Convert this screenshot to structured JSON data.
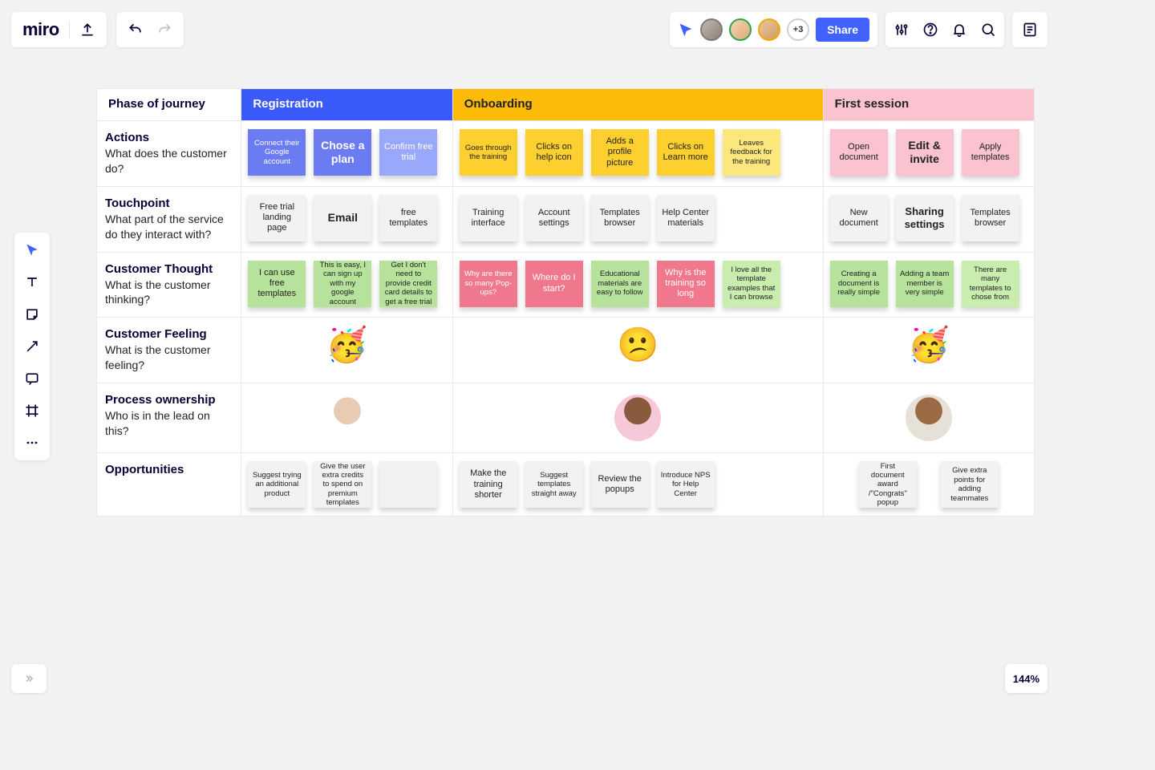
{
  "app": {
    "logo": "miro"
  },
  "toolbar": {
    "share_label": "Share",
    "avatar_overflow": "+3"
  },
  "zoom": "144%",
  "phases": {
    "label": "Phase of journey",
    "registration": "Registration",
    "onboarding": "Onboarding",
    "first_session": "First session"
  },
  "rows": {
    "actions": {
      "title": "Actions",
      "sub": "What does the customer do?"
    },
    "touchpoint": {
      "title": "Touchpoint",
      "sub": "What part of the service do they interact with?"
    },
    "thought": {
      "title": "Customer Thought",
      "sub": "What is the customer thinking?"
    },
    "feeling": {
      "title": "Customer Feeling",
      "sub": "What is the customer feeling?"
    },
    "ownership": {
      "title": "Process ownership",
      "sub": "Who is in the lead on this?"
    },
    "opportunities": {
      "title": "Opportunities",
      "sub": ""
    }
  },
  "actions": {
    "reg": [
      "Connect their Google account",
      "Chose a plan",
      "Confirm free trial"
    ],
    "onb": [
      "Goes through the training",
      "Clicks on help icon",
      "Adds a profile picture",
      "Clicks on Learn more",
      "Leaves feedback for the training"
    ],
    "fs": [
      "Open document",
      "Edit & invite",
      "Apply templates"
    ]
  },
  "touchpoint": {
    "reg": [
      "Free trial landing page",
      "Email",
      "free templates"
    ],
    "onb": [
      "Training interface",
      "Account settings",
      "Templates browser",
      "Help Center materials"
    ],
    "fs": [
      "New document",
      "Sharing settings",
      "Templates browser"
    ]
  },
  "thought": {
    "reg": [
      "I can use free templates",
      "This is easy, I can sign up with my google account",
      "Get I don't need to provide credit card details to get a free trial"
    ],
    "onb": [
      "Why are there so many Pop-ups?",
      "Where do I start?",
      "Educational materials are easy to follow",
      "Why is the training so long",
      "I love all the template examples that I can browse"
    ],
    "fs": [
      "Creating a document is really simple",
      "Adding a team member is very simple",
      "There are many templates to chose from"
    ]
  },
  "feeling": {
    "reg": "🥳",
    "onb": "😕",
    "fs": "🥳"
  },
  "opportunities": {
    "reg": [
      "Suggest trying an additional product",
      "Give the user extra credits to spend on premium templates",
      ""
    ],
    "onb": [
      "Make the training shorter",
      "Suggest templates straight away",
      "Review the popups",
      "Introduce NPS for Help Center"
    ],
    "fs": [
      "First document award /\"Congrats\" popup",
      "Give extra points for adding teammates"
    ]
  }
}
